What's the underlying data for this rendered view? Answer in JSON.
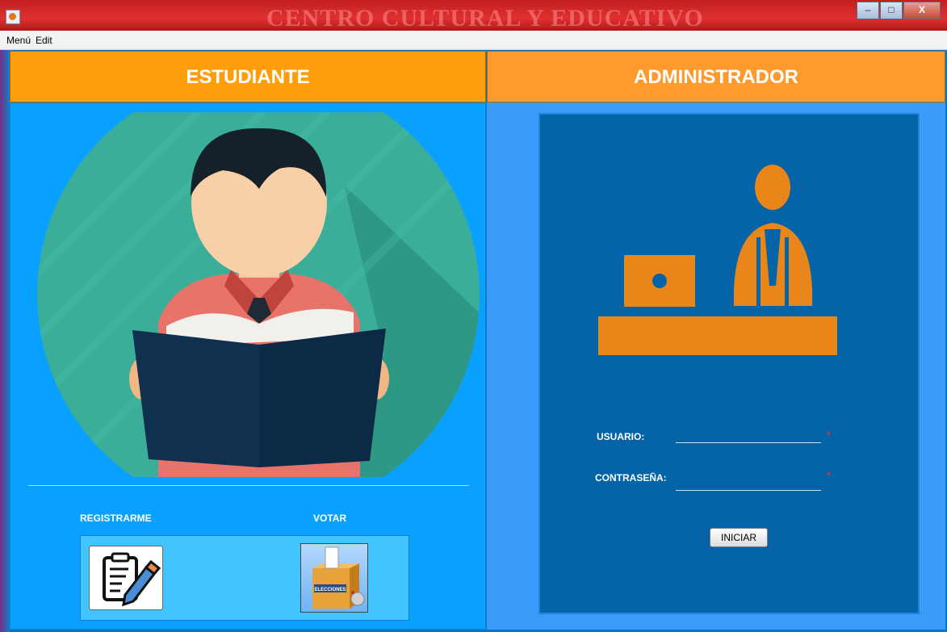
{
  "window": {
    "title_partial": "CENTRO CULTURAL Y EDUCATIVO",
    "minimize_glyph": "–",
    "maximize_glyph": "□",
    "close_glyph": "X"
  },
  "menubar": {
    "items": [
      "Menú",
      "Edit"
    ]
  },
  "student_panel": {
    "header": "ESTUDIANTE",
    "register_label": "REGISTRARME",
    "vote_label": "VOTAR",
    "ballot_box_text": "ELECCIONES",
    "register_icon": "form-edit-icon",
    "vote_icon": "ballot-box-icon"
  },
  "admin_panel": {
    "header": "ADMINISTRADOR",
    "username_label": "USUARIO:",
    "username_value": "",
    "password_label": "CONTRASEÑA:",
    "password_value": "",
    "required_marker": "*",
    "login_button": "INICIAR"
  },
  "colors": {
    "header_orange": "#ff9d0a",
    "student_bg": "#0aa0ff",
    "admin_bg": "#0563a8",
    "admin_icon_orange": "#e8861a",
    "circle_green": "#3aae98"
  }
}
